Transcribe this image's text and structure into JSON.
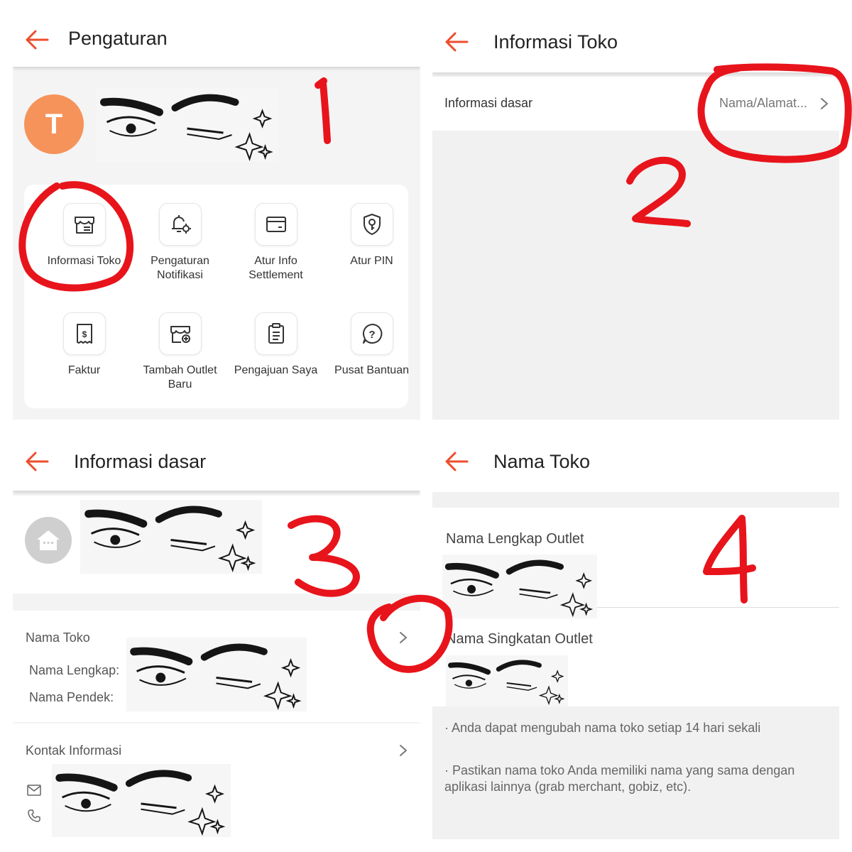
{
  "panel1": {
    "title": "Pengaturan",
    "avatar_letter": "T",
    "menu": [
      {
        "label": "Informasi Toko",
        "icon": "store-icon"
      },
      {
        "label": "Pengaturan Notifikasi",
        "icon": "bell-gear-icon"
      },
      {
        "label": "Atur Info Settlement",
        "icon": "card-icon"
      },
      {
        "label": "Atur PIN",
        "icon": "shield-key-icon"
      },
      {
        "label": "Faktur",
        "icon": "receipt-icon"
      },
      {
        "label": "Tambah Outlet Baru",
        "icon": "store-add-icon"
      },
      {
        "label": "Pengajuan Saya",
        "icon": "clipboard-icon"
      },
      {
        "label": "Pusat Bantuan",
        "icon": "help-icon"
      }
    ],
    "annotation": "1"
  },
  "panel2": {
    "title": "Informasi Toko",
    "row_label": "Informasi dasar",
    "row_value": "Nama/Alamat...",
    "annotation": "2"
  },
  "panel3": {
    "title": "Informasi dasar",
    "nama_toko": {
      "heading": "Nama Toko",
      "full_label": "Nama Lengkap:",
      "short_label": "Nama Pendek:"
    },
    "kontak": {
      "heading": "Kontak Informasi"
    },
    "annotation": "3"
  },
  "panel4": {
    "title": "Nama Toko",
    "full_name_label": "Nama Lengkap Outlet",
    "short_name_label": "Nama Singkatan Outlet",
    "notes": [
      "· Anda dapat mengubah nama toko setiap 14 hari sekali",
      "· Pastikan nama toko Anda memiliki nama yang sama dengan aplikasi lainnya (grab merchant, gobiz, etc)."
    ],
    "annotation": "4"
  },
  "colors": {
    "accent": "#ee4d2d",
    "avatar": "#f5935a",
    "annotation": "#e8141b"
  }
}
